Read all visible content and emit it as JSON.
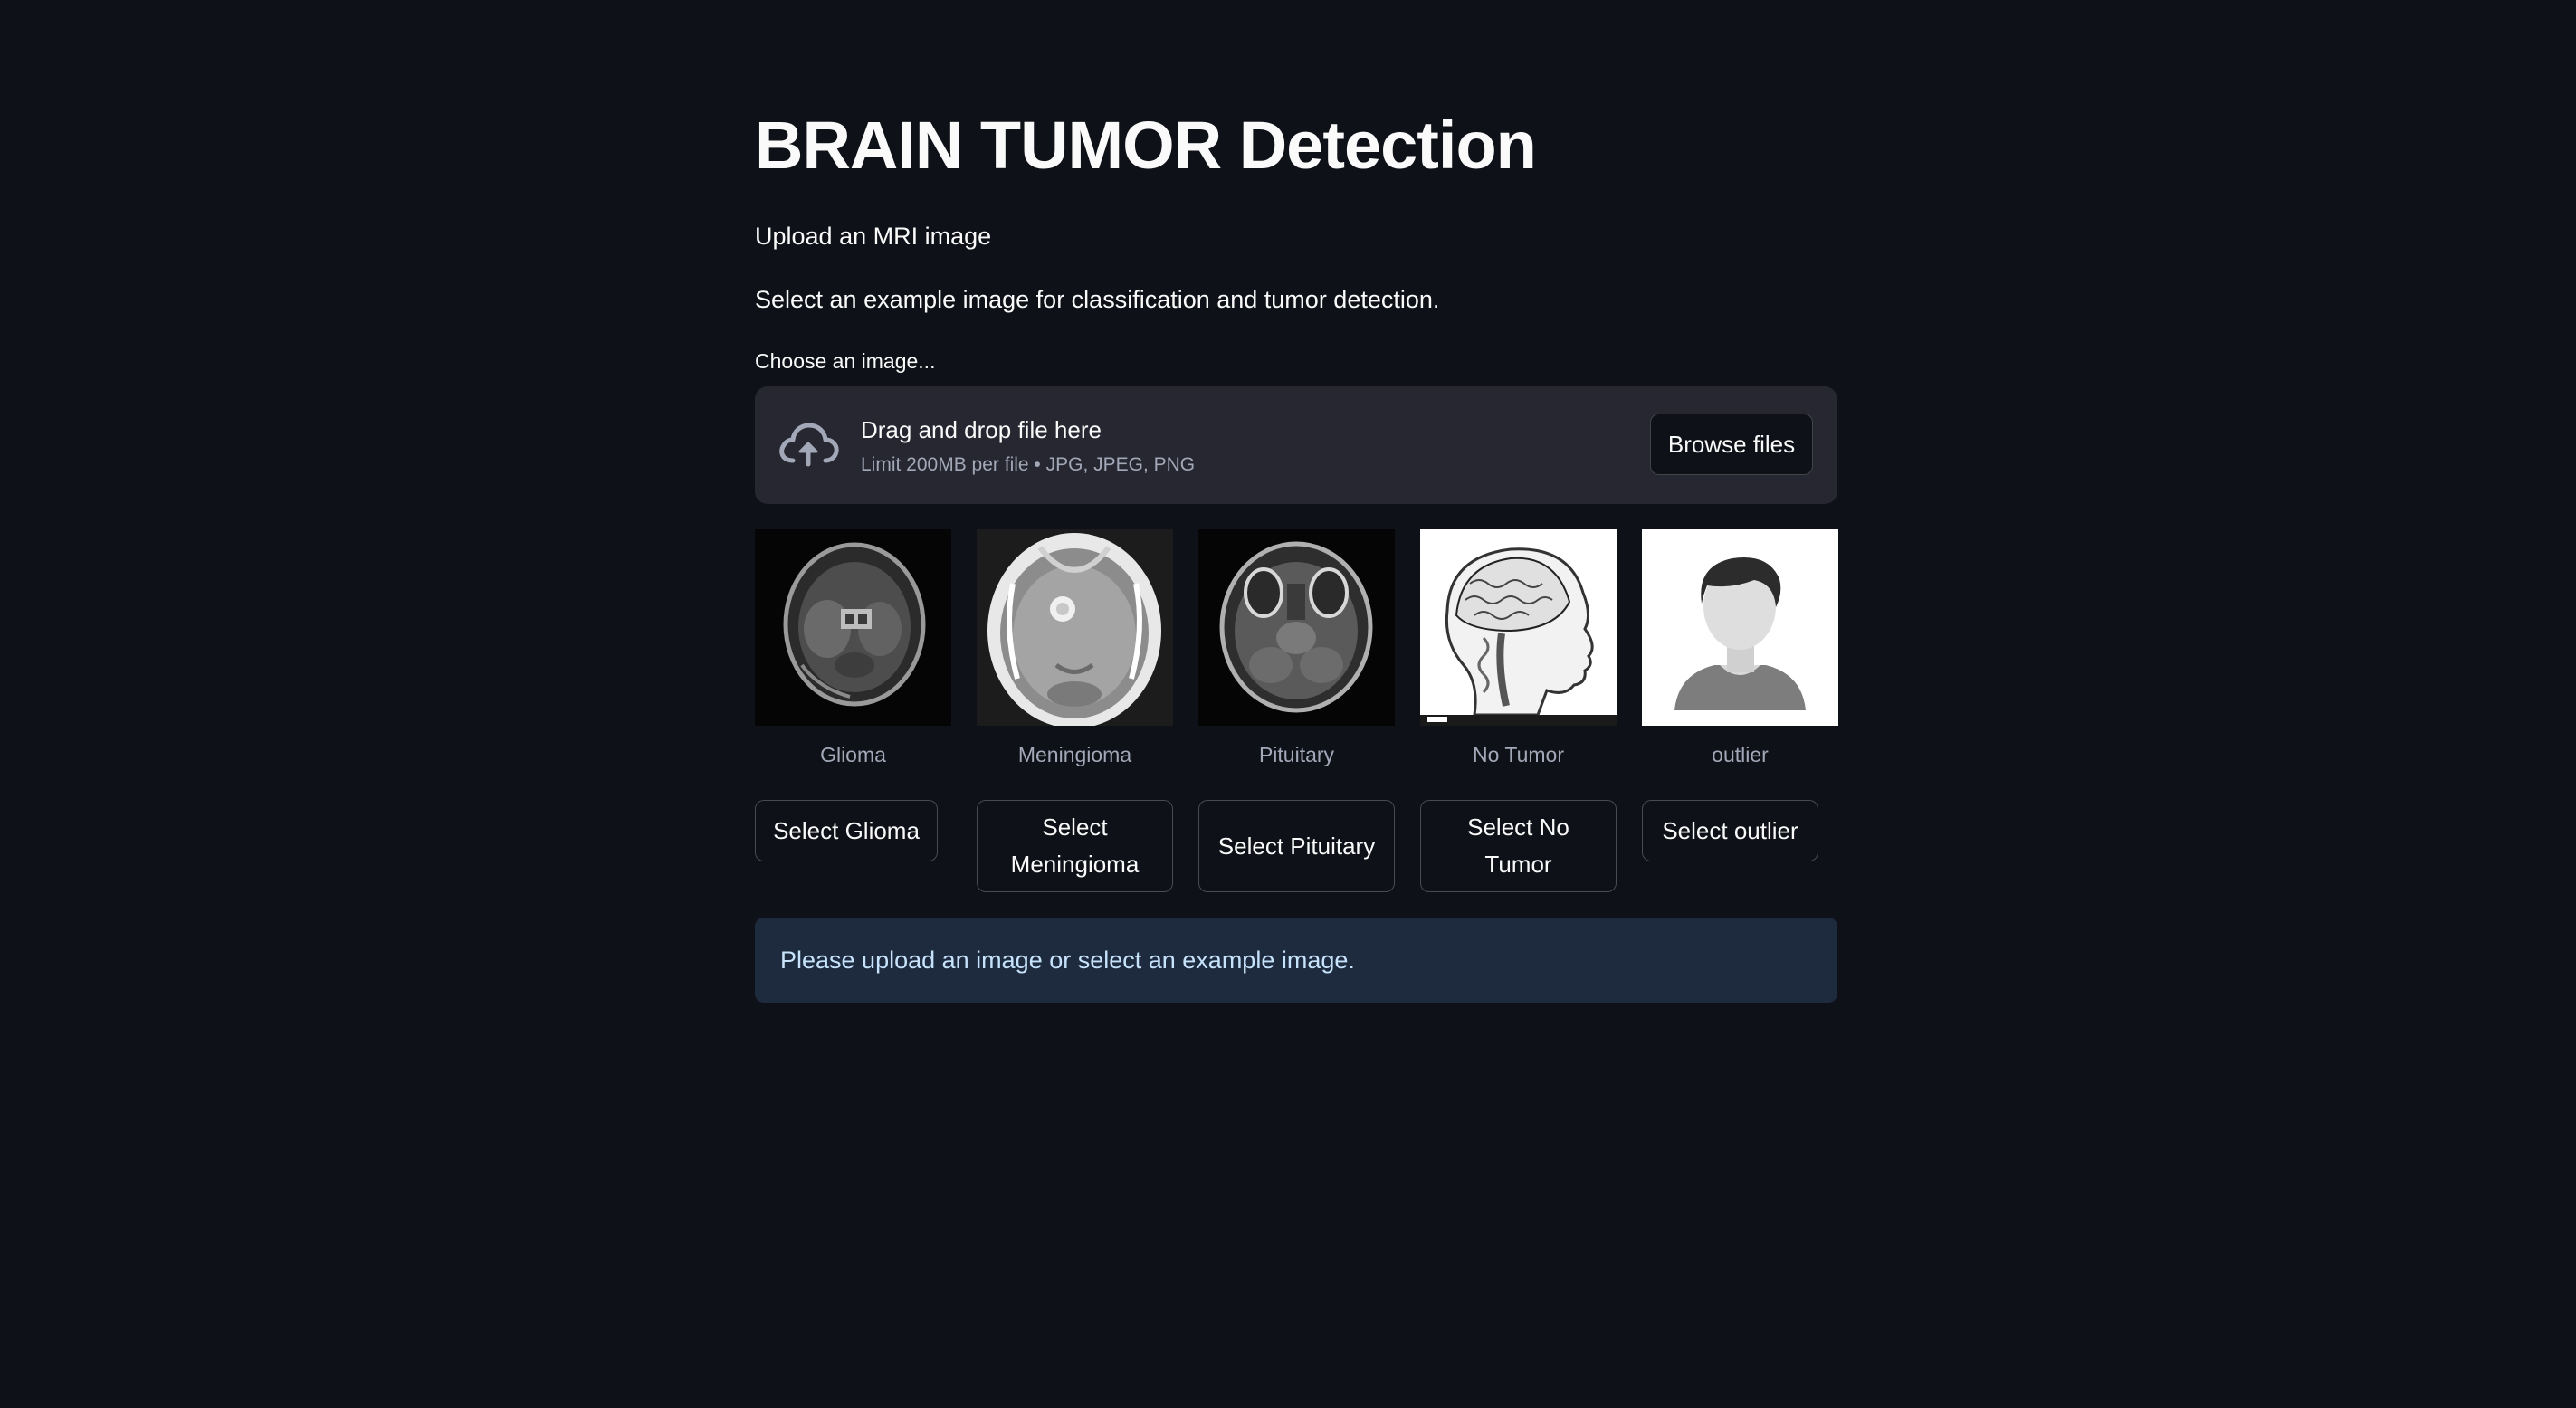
{
  "page": {
    "title": "BRAIN TUMOR Detection",
    "intro": "Upload an MRI image",
    "instruction": "Select an example image for classification and tumor detection."
  },
  "uploader": {
    "label": "Choose an image...",
    "drag_text": "Drag and drop file here",
    "limit_text": "Limit 200MB per file • JPG, JPEG, PNG",
    "browse_label": "Browse files",
    "icon": "cloud-upload-icon"
  },
  "examples": [
    {
      "caption": "Glioma",
      "button_label": "Select Glioma"
    },
    {
      "caption": "Meningioma",
      "button_label": "Select Meningioma"
    },
    {
      "caption": "Pituitary",
      "button_label": "Select Pituitary"
    },
    {
      "caption": "No Tumor",
      "button_label": "Select No Tumor"
    },
    {
      "caption": "outlier",
      "button_label": "Select outlier"
    }
  ],
  "info_message": "Please upload an image or select an example image.",
  "colors": {
    "background": "#0e1117",
    "dropzone": "#262730",
    "info_background": "#1e2b3f",
    "info_text": "#c7e3fb",
    "text": "#fafafa",
    "muted_text": "#a3a8b8"
  }
}
